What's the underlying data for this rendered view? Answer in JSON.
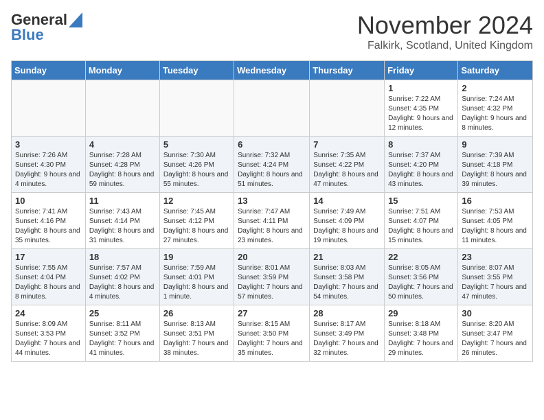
{
  "logo": {
    "line1": "General",
    "line2": "Blue"
  },
  "title": "November 2024",
  "location": "Falkirk, Scotland, United Kingdom",
  "weekdays": [
    "Sunday",
    "Monday",
    "Tuesday",
    "Wednesday",
    "Thursday",
    "Friday",
    "Saturday"
  ],
  "weeks": [
    [
      {
        "day": "",
        "info": ""
      },
      {
        "day": "",
        "info": ""
      },
      {
        "day": "",
        "info": ""
      },
      {
        "day": "",
        "info": ""
      },
      {
        "day": "",
        "info": ""
      },
      {
        "day": "1",
        "info": "Sunrise: 7:22 AM\nSunset: 4:35 PM\nDaylight: 9 hours and 12 minutes."
      },
      {
        "day": "2",
        "info": "Sunrise: 7:24 AM\nSunset: 4:32 PM\nDaylight: 9 hours and 8 minutes."
      }
    ],
    [
      {
        "day": "3",
        "info": "Sunrise: 7:26 AM\nSunset: 4:30 PM\nDaylight: 9 hours and 4 minutes."
      },
      {
        "day": "4",
        "info": "Sunrise: 7:28 AM\nSunset: 4:28 PM\nDaylight: 8 hours and 59 minutes."
      },
      {
        "day": "5",
        "info": "Sunrise: 7:30 AM\nSunset: 4:26 PM\nDaylight: 8 hours and 55 minutes."
      },
      {
        "day": "6",
        "info": "Sunrise: 7:32 AM\nSunset: 4:24 PM\nDaylight: 8 hours and 51 minutes."
      },
      {
        "day": "7",
        "info": "Sunrise: 7:35 AM\nSunset: 4:22 PM\nDaylight: 8 hours and 47 minutes."
      },
      {
        "day": "8",
        "info": "Sunrise: 7:37 AM\nSunset: 4:20 PM\nDaylight: 8 hours and 43 minutes."
      },
      {
        "day": "9",
        "info": "Sunrise: 7:39 AM\nSunset: 4:18 PM\nDaylight: 8 hours and 39 minutes."
      }
    ],
    [
      {
        "day": "10",
        "info": "Sunrise: 7:41 AM\nSunset: 4:16 PM\nDaylight: 8 hours and 35 minutes."
      },
      {
        "day": "11",
        "info": "Sunrise: 7:43 AM\nSunset: 4:14 PM\nDaylight: 8 hours and 31 minutes."
      },
      {
        "day": "12",
        "info": "Sunrise: 7:45 AM\nSunset: 4:12 PM\nDaylight: 8 hours and 27 minutes."
      },
      {
        "day": "13",
        "info": "Sunrise: 7:47 AM\nSunset: 4:11 PM\nDaylight: 8 hours and 23 minutes."
      },
      {
        "day": "14",
        "info": "Sunrise: 7:49 AM\nSunset: 4:09 PM\nDaylight: 8 hours and 19 minutes."
      },
      {
        "day": "15",
        "info": "Sunrise: 7:51 AM\nSunset: 4:07 PM\nDaylight: 8 hours and 15 minutes."
      },
      {
        "day": "16",
        "info": "Sunrise: 7:53 AM\nSunset: 4:05 PM\nDaylight: 8 hours and 11 minutes."
      }
    ],
    [
      {
        "day": "17",
        "info": "Sunrise: 7:55 AM\nSunset: 4:04 PM\nDaylight: 8 hours and 8 minutes."
      },
      {
        "day": "18",
        "info": "Sunrise: 7:57 AM\nSunset: 4:02 PM\nDaylight: 8 hours and 4 minutes."
      },
      {
        "day": "19",
        "info": "Sunrise: 7:59 AM\nSunset: 4:01 PM\nDaylight: 8 hours and 1 minute."
      },
      {
        "day": "20",
        "info": "Sunrise: 8:01 AM\nSunset: 3:59 PM\nDaylight: 7 hours and 57 minutes."
      },
      {
        "day": "21",
        "info": "Sunrise: 8:03 AM\nSunset: 3:58 PM\nDaylight: 7 hours and 54 minutes."
      },
      {
        "day": "22",
        "info": "Sunrise: 8:05 AM\nSunset: 3:56 PM\nDaylight: 7 hours and 50 minutes."
      },
      {
        "day": "23",
        "info": "Sunrise: 8:07 AM\nSunset: 3:55 PM\nDaylight: 7 hours and 47 minutes."
      }
    ],
    [
      {
        "day": "24",
        "info": "Sunrise: 8:09 AM\nSunset: 3:53 PM\nDaylight: 7 hours and 44 minutes."
      },
      {
        "day": "25",
        "info": "Sunrise: 8:11 AM\nSunset: 3:52 PM\nDaylight: 7 hours and 41 minutes."
      },
      {
        "day": "26",
        "info": "Sunrise: 8:13 AM\nSunset: 3:51 PM\nDaylight: 7 hours and 38 minutes."
      },
      {
        "day": "27",
        "info": "Sunrise: 8:15 AM\nSunset: 3:50 PM\nDaylight: 7 hours and 35 minutes."
      },
      {
        "day": "28",
        "info": "Sunrise: 8:17 AM\nSunset: 3:49 PM\nDaylight: 7 hours and 32 minutes."
      },
      {
        "day": "29",
        "info": "Sunrise: 8:18 AM\nSunset: 3:48 PM\nDaylight: 7 hours and 29 minutes."
      },
      {
        "day": "30",
        "info": "Sunrise: 8:20 AM\nSunset: 3:47 PM\nDaylight: 7 hours and 26 minutes."
      }
    ]
  ]
}
